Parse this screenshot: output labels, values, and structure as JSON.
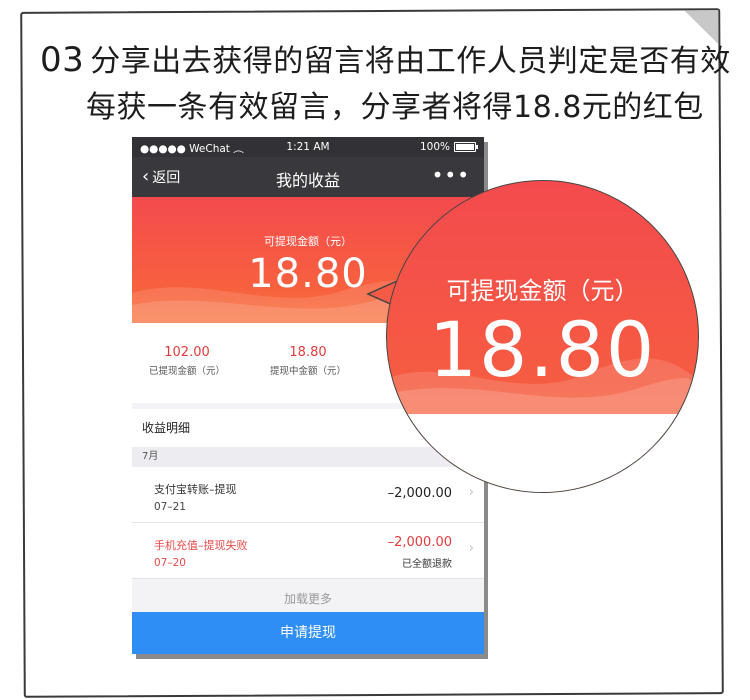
{
  "caption": {
    "number": "03",
    "line1": "分享出去获得的留言将由工作人员判定是否有效",
    "line2": "每获一条有效留言，分享者将得18.8元的红包"
  },
  "status_bar": {
    "carrier": "●●●●● WeChat",
    "time": "1:21 AM",
    "battery": "100%"
  },
  "nav": {
    "back_label": "返回",
    "title": "我的收益",
    "more": "•••"
  },
  "hero": {
    "label": "可提现金额（元）",
    "amount": "18.80"
  },
  "stats": [
    {
      "value": "102.00",
      "label": "已提现金额（元）"
    },
    {
      "value": "18.80",
      "label": "提现中金额（元）"
    }
  ],
  "details": {
    "title": "收益明细",
    "month": "7月",
    "rows": [
      {
        "name": "支付宝转账–提现",
        "date": "07–21",
        "amount": "–2,000.00",
        "note": ""
      },
      {
        "name": "手机充值–提现失败",
        "date": "07–20",
        "amount": "–2,000.00",
        "note": "已全额退款"
      }
    ],
    "load_more": "加载更多"
  },
  "apply_button": "申请提现",
  "magnifier": {
    "label": "可提现金额（元）",
    "amount": "18.80"
  },
  "colors": {
    "hero_red": "#f44a4e",
    "accent_blue": "#2f8ef3",
    "amount_red": "#e23b3b"
  }
}
